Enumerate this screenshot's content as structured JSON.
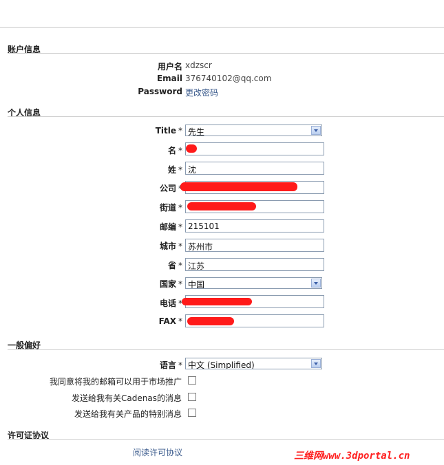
{
  "account": {
    "title": "账户信息",
    "username_label": "用户名",
    "username": "xdzscr",
    "email_label": "Email",
    "email": "376740102@qq.com",
    "password_label": "Password",
    "password_link": "更改密码"
  },
  "personal": {
    "title": "个人信息",
    "required_mark": "*",
    "fields": {
      "title_label": "Title",
      "title_value": "先生",
      "firstname_label": "名",
      "lastname_label": "姓",
      "lastname_value": "沈",
      "company_label": "公司",
      "street_label": "街道",
      "zip_label": "邮编",
      "zip_value": "215101",
      "city_label": "城市",
      "city_value": "苏州市",
      "province_label": "省",
      "province_value": "江苏",
      "country_label": "国家",
      "country_value": "中国",
      "phone_label": "电话",
      "fax_label": "FAX"
    }
  },
  "preferences": {
    "title": "一般偏好",
    "language_label": "语言",
    "language_value": "中文 (Simplified)",
    "opt_marketing": "我同意将我的邮箱可以用于市场推广",
    "opt_cadenas": "发送给我有关Cadenas的消息",
    "opt_special": "发送给我有关产品的特别消息"
  },
  "license": {
    "title": "许可证协议",
    "read_link": "阅读许可协议"
  },
  "watermark": "三维网www.3dportal.cn",
  "colors": {
    "redaction": "#ff1a1a",
    "link": "#3a5a8c",
    "watermark": "#ff2020"
  }
}
